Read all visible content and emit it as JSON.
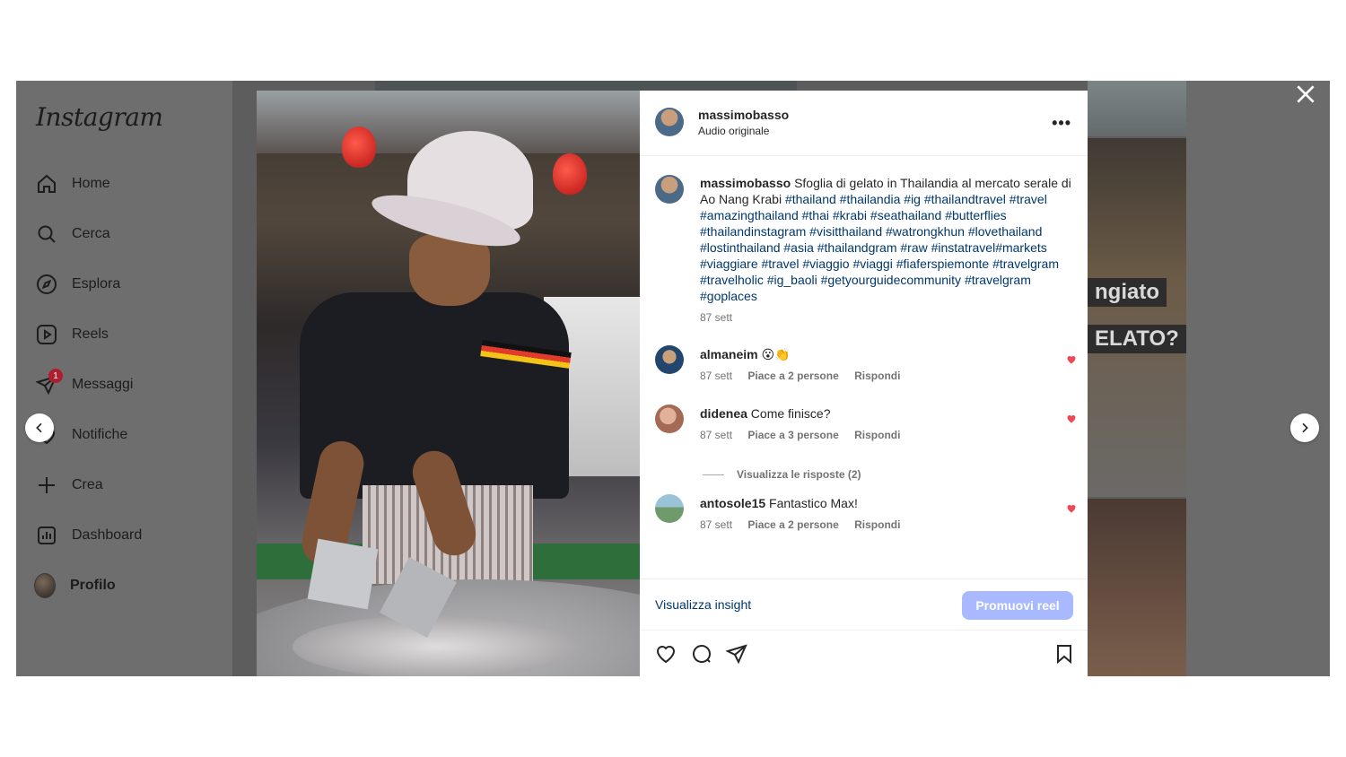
{
  "sidebar": {
    "logo": "Instagram",
    "items": [
      {
        "label": "Home",
        "icon": "home-icon"
      },
      {
        "label": "Cerca",
        "icon": "search-icon"
      },
      {
        "label": "Esplora",
        "icon": "compass-icon"
      },
      {
        "label": "Reels",
        "icon": "reels-icon"
      },
      {
        "label": "Messaggi",
        "icon": "messenger-icon",
        "badge": "1"
      },
      {
        "label": "Notifiche",
        "icon": "heart-icon"
      },
      {
        "label": "Crea",
        "icon": "plus-icon"
      },
      {
        "label": "Dashboard",
        "icon": "dashboard-icon"
      },
      {
        "label": "Profilo",
        "icon": "avatar"
      }
    ]
  },
  "background": {
    "overlay_text_1": "ngiato",
    "overlay_text_2": "ELATO?"
  },
  "post": {
    "username": "massimobasso",
    "audio": "Audio originale",
    "more_label": "•••",
    "caption": {
      "user": "massimobasso",
      "text": "Sfoglia di gelato in Thailandia al mercato serale di Ao Nang Krabi",
      "hashtags": "#thailand #thailandia #ig #thailandtravel #travel #amazingthailand #thai #krabi #seathailand #butterflies #thailandinstagram #visitthailand #watrongkhun #lovethailand #lostinthailand #asia #thailandgram #raw #instatravel#markets #viaggiare #travel #viaggio #viaggi #fiaferspiemonte #travelgram #travelholic #ig_baoli #getyourguidecommunity #travelgram #goplaces",
      "time": "87 sett"
    },
    "comments": [
      {
        "user": "almaneim",
        "text": "😮👏",
        "time": "87 sett",
        "likes": "Piace a 2 persone",
        "reply": "Rispondi"
      },
      {
        "user": "didenea",
        "text": "Come finisce?",
        "time": "87 sett",
        "likes": "Piace a 3 persone",
        "reply": "Rispondi"
      },
      {
        "user": "antosole15",
        "text": "Fantastico Max!",
        "time": "87 sett",
        "likes": "Piace a 2 persone",
        "reply": "Rispondi"
      }
    ],
    "view_replies": "Visualizza le risposte (2)",
    "insights_label": "Visualizza insight",
    "promote_label": "Promuovi reel"
  },
  "colors": {
    "link": "#00376b",
    "promote_bg": "#a8b9ff",
    "like_red": "#ed4956",
    "badge_red": "#b01d2e"
  }
}
